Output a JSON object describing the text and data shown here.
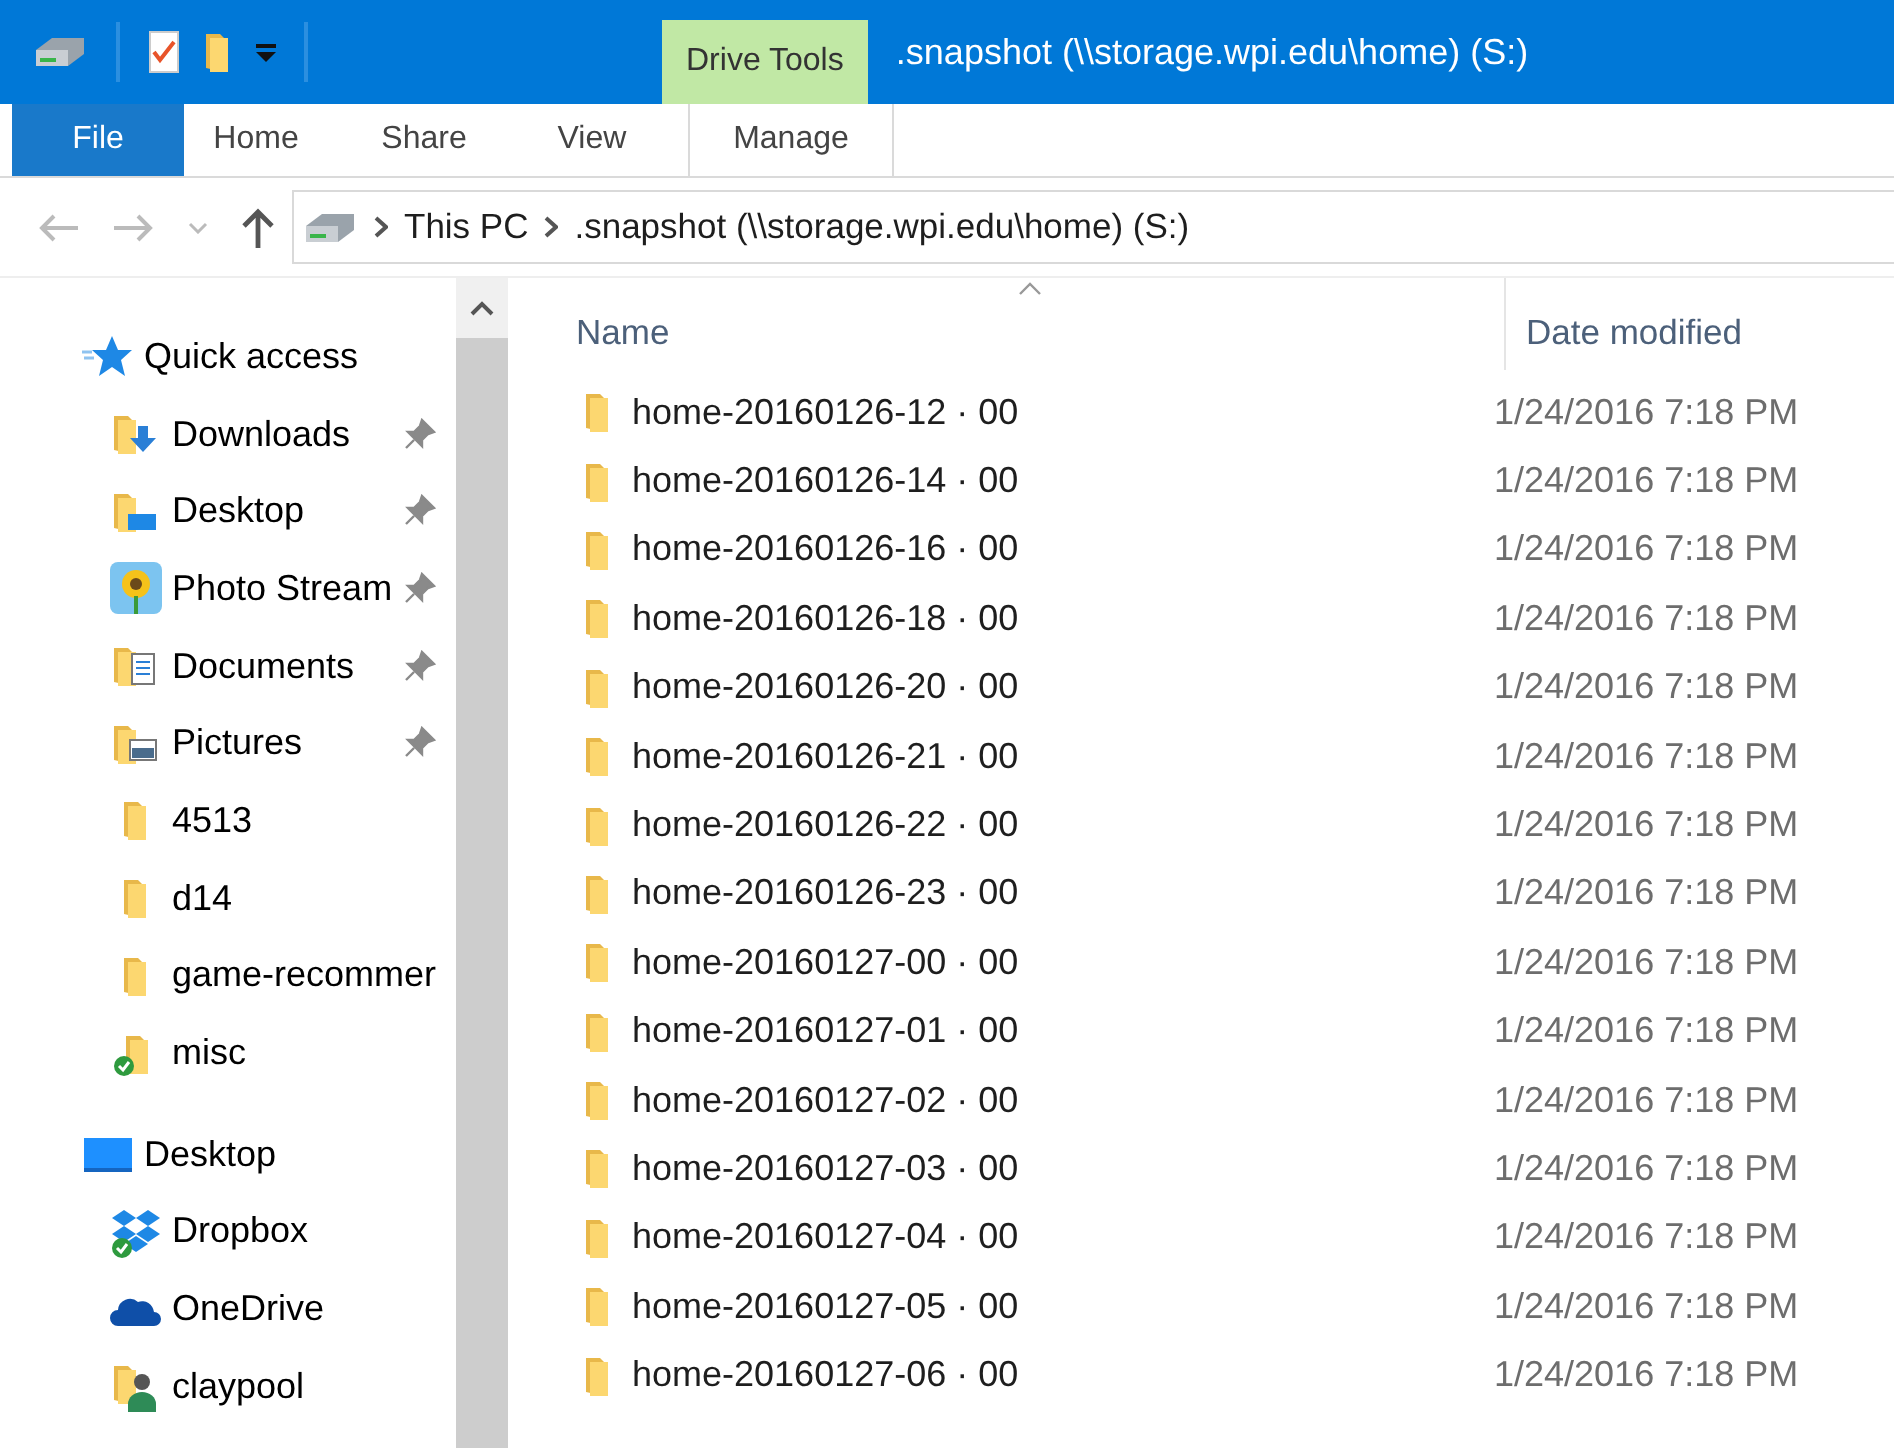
{
  "title_bar": {
    "context_tab": "Drive Tools",
    "title": ".snapshot (\\\\storage.wpi.edu\\home) (S:)"
  },
  "ribbon_tabs": [
    {
      "label": "File",
      "kind": "file"
    },
    {
      "label": "Home",
      "kind": "plain"
    },
    {
      "label": "Share",
      "kind": "plain"
    },
    {
      "label": "View",
      "kind": "plain"
    },
    {
      "label": "Manage",
      "kind": "context"
    }
  ],
  "address_bar": {
    "segments": [
      "This PC",
      ".snapshot (\\\\storage.wpi.edu\\home) (S:)"
    ]
  },
  "navigation": [
    {
      "label": "Quick access",
      "kind": "star",
      "selected": false,
      "children": [
        {
          "label": "Downloads",
          "kind": "downloads",
          "pinned": true,
          "selected": false
        },
        {
          "label": "Desktop",
          "kind": "desktop-folder",
          "pinned": true,
          "selected": false
        },
        {
          "label": "Photo Stream",
          "kind": "photos",
          "pinned": true,
          "selected": false
        },
        {
          "label": "Documents",
          "kind": "documents",
          "pinned": true,
          "selected": false
        },
        {
          "label": "Pictures",
          "kind": "pictures",
          "pinned": true,
          "selected": false
        },
        {
          "label": "4513",
          "kind": "folder",
          "pinned": false,
          "selected": false
        },
        {
          "label": "d14",
          "kind": "folder",
          "pinned": false,
          "selected": false
        },
        {
          "label": "game-recommer",
          "kind": "folder",
          "pinned": false,
          "selected": false
        },
        {
          "label": "misc",
          "kind": "synced-folder",
          "pinned": false,
          "selected": false
        }
      ]
    },
    {
      "label": "Desktop",
      "kind": "monitor",
      "selected": false,
      "children": [
        {
          "label": "Dropbox",
          "kind": "dropbox",
          "pinned": false,
          "selected": false
        },
        {
          "label": "OneDrive",
          "kind": "cloud",
          "pinned": false,
          "selected": false
        },
        {
          "label": "claypool",
          "kind": "user",
          "pinned": false,
          "selected": false
        }
      ]
    }
  ],
  "file_list": {
    "columns": [
      "Name",
      "Date modified"
    ],
    "rows": [
      {
        "name": "home-20160126-12 · 00",
        "date": "1/24/2016 7:18 PM"
      },
      {
        "name": "home-20160126-14 · 00",
        "date": "1/24/2016 7:18 PM"
      },
      {
        "name": "home-20160126-16 · 00",
        "date": "1/24/2016 7:18 PM"
      },
      {
        "name": "home-20160126-18 · 00",
        "date": "1/24/2016 7:18 PM"
      },
      {
        "name": "home-20160126-20 · 00",
        "date": "1/24/2016 7:18 PM"
      },
      {
        "name": "home-20160126-21 · 00",
        "date": "1/24/2016 7:18 PM"
      },
      {
        "name": "home-20160126-22 · 00",
        "date": "1/24/2016 7:18 PM"
      },
      {
        "name": "home-20160126-23 · 00",
        "date": "1/24/2016 7:18 PM"
      },
      {
        "name": "home-20160127-00 · 00",
        "date": "1/24/2016 7:18 PM"
      },
      {
        "name": "home-20160127-01 · 00",
        "date": "1/24/2016 7:18 PM"
      },
      {
        "name": "home-20160127-02 · 00",
        "date": "1/24/2016 7:18 PM"
      },
      {
        "name": "home-20160127-03 · 00",
        "date": "1/24/2016 7:18 PM"
      },
      {
        "name": "home-20160127-04 · 00",
        "date": "1/24/2016 7:18 PM"
      },
      {
        "name": "home-20160127-05 · 00",
        "date": "1/24/2016 7:18 PM"
      },
      {
        "name": "home-20160127-06 · 00",
        "date": "1/24/2016 7:18 PM"
      }
    ]
  }
}
